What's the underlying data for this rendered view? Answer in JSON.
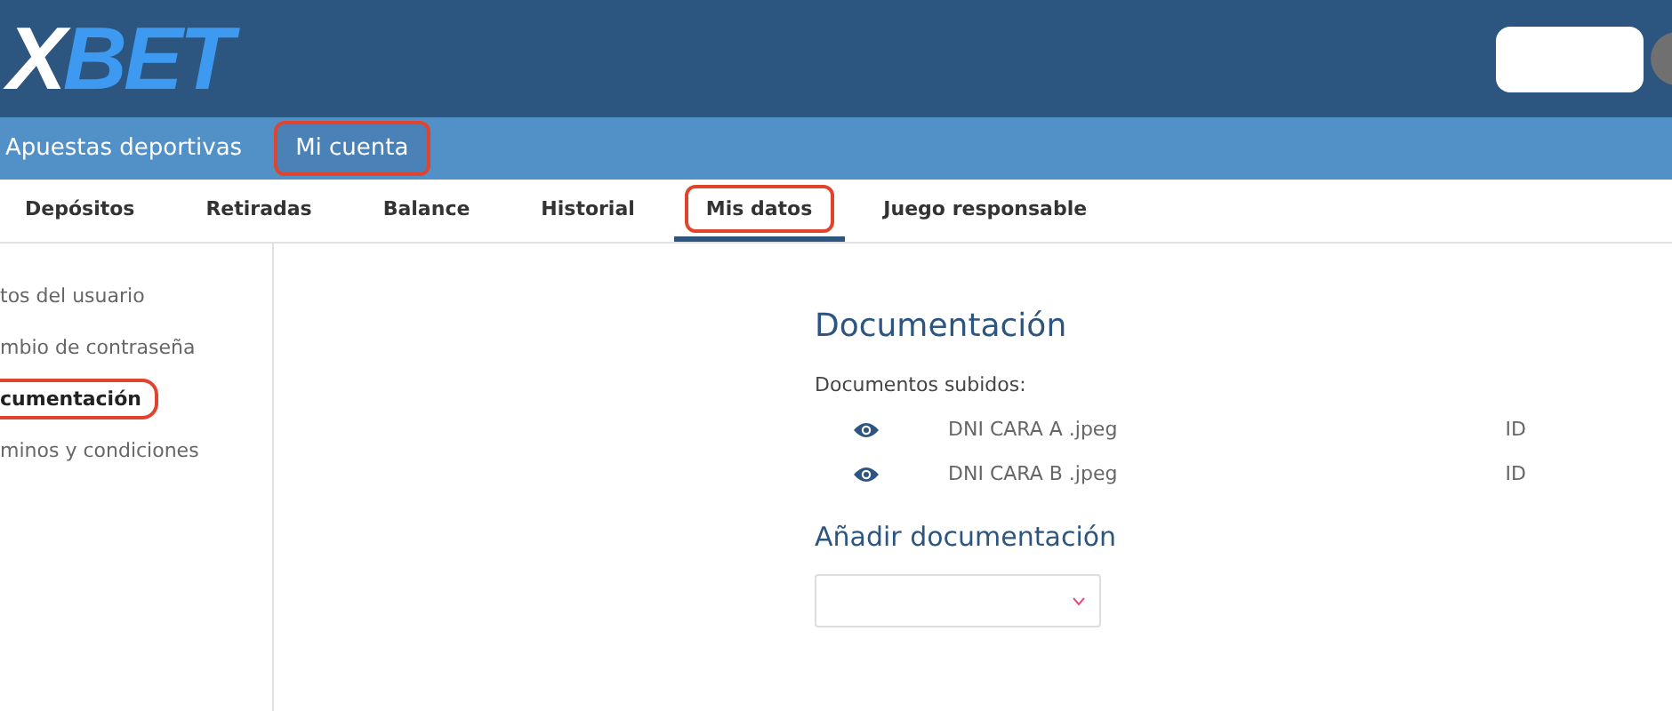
{
  "logo": {
    "part_1": "X",
    "part_2": "BET"
  },
  "main_nav": [
    {
      "label": "Apuestas deportivas",
      "selected": false,
      "highlighted": false
    },
    {
      "label": "Mi cuenta",
      "selected": true,
      "highlighted": true
    }
  ],
  "tabs": [
    {
      "label": "Depósitos",
      "selected": false,
      "highlighted": false
    },
    {
      "label": "Retiradas",
      "selected": false,
      "highlighted": false
    },
    {
      "label": "Balance",
      "selected": false,
      "highlighted": false
    },
    {
      "label": "Historial",
      "selected": false,
      "highlighted": false
    },
    {
      "label": "Mis datos",
      "selected": true,
      "highlighted": true
    },
    {
      "label": "Juego responsable",
      "selected": false,
      "highlighted": false
    }
  ],
  "sidebar": {
    "items": [
      {
        "label": "tos del usuario",
        "selected": false,
        "highlighted": false
      },
      {
        "label": "mbio de contraseña",
        "selected": false,
        "highlighted": false
      },
      {
        "label": "cumentación",
        "selected": true,
        "highlighted": true
      },
      {
        "label": "minos y condiciones",
        "selected": false,
        "highlighted": false
      }
    ]
  },
  "content": {
    "title": "Documentación",
    "uploaded_label": "Documentos subidos:",
    "documents": [
      {
        "name": "DNI CARA A .jpeg",
        "type": "ID"
      },
      {
        "name": "DNI CARA B .jpeg",
        "type": "ID"
      }
    ],
    "add_title": "Añadir documentación"
  }
}
